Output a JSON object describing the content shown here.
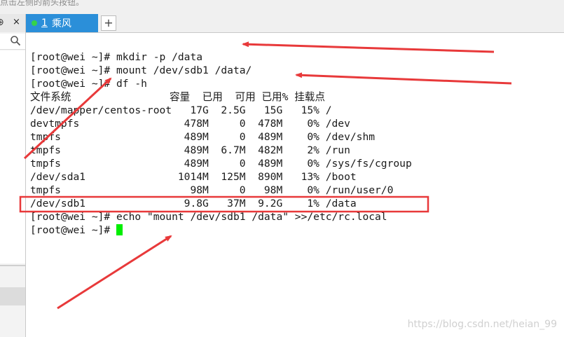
{
  "top_hint": "点击左侧的箭头按钮。",
  "side": {
    "pin_glyph": "⊕",
    "close_glyph": "×"
  },
  "tab": {
    "number": "1",
    "name": "乘风",
    "add_glyph": "+"
  },
  "terminal": {
    "lines": [
      "[root@wei ~]# mkdir -p /data",
      "[root@wei ~]# mount /dev/sdb1 /data/",
      "[root@wei ~]# df -h",
      "文件系统                容量  已用  可用 已用% 挂载点",
      "/dev/mapper/centos-root   17G  2.5G   15G   15% /",
      "devtmpfs                 478M     0  478M    0% /dev",
      "tmpfs                    489M     0  489M    0% /dev/shm",
      "tmpfs                    489M  6.7M  482M    2% /run",
      "tmpfs                    489M     0  489M    0% /sys/fs/cgroup",
      "/dev/sda1               1014M  125M  890M   13% /boot",
      "tmpfs                     98M     0   98M    0% /run/user/0",
      "/dev/sdb1                9.8G   37M  9.2G    1% /data",
      "[root@wei ~]# echo \"mount /dev/sdb1 /data\" >>/etc/rc.local",
      "[root@wei ~]# "
    ]
  },
  "watermark": "https://blog.csdn.net/heian_99",
  "colors": {
    "tab": "#2b8fd9",
    "cursor": "#00ee00",
    "annotation": "#e8393a"
  }
}
